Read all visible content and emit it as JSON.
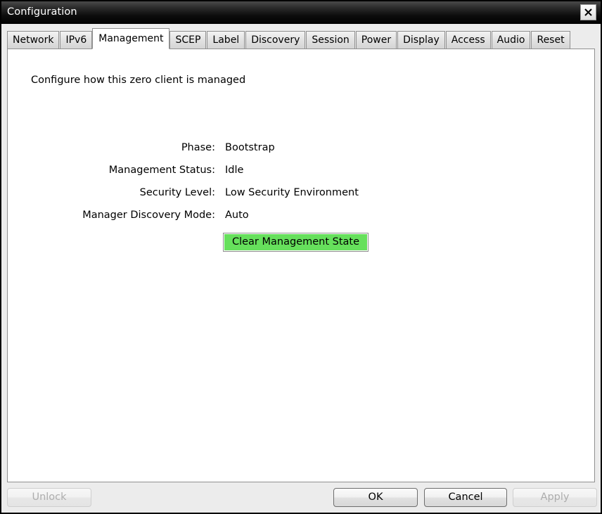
{
  "window": {
    "title": "Configuration",
    "close_icon": "close-icon"
  },
  "tabs": [
    {
      "label": "Network",
      "active": false
    },
    {
      "label": "IPv6",
      "active": false
    },
    {
      "label": "Management",
      "active": true
    },
    {
      "label": "SCEP",
      "active": false
    },
    {
      "label": "Label",
      "active": false
    },
    {
      "label": "Discovery",
      "active": false
    },
    {
      "label": "Session",
      "active": false
    },
    {
      "label": "Power",
      "active": false
    },
    {
      "label": "Display",
      "active": false
    },
    {
      "label": "Access",
      "active": false
    },
    {
      "label": "Audio",
      "active": false
    },
    {
      "label": "Reset",
      "active": false
    }
  ],
  "main": {
    "intro": "Configure how this zero client is managed",
    "fields": [
      {
        "label": "Phase:",
        "value": "Bootstrap"
      },
      {
        "label": "Management Status:",
        "value": "Idle"
      },
      {
        "label": "Security Level:",
        "value": "Low Security Environment"
      },
      {
        "label": "Manager Discovery Mode:",
        "value": "Auto"
      }
    ],
    "clear_button": {
      "label": "Clear Management State",
      "color": "#66e05c"
    }
  },
  "footer": {
    "unlock": {
      "label": "Unlock",
      "enabled": false
    },
    "ok": {
      "label": "OK",
      "enabled": true
    },
    "cancel": {
      "label": "Cancel",
      "enabled": true
    },
    "apply": {
      "label": "Apply",
      "enabled": false
    }
  }
}
